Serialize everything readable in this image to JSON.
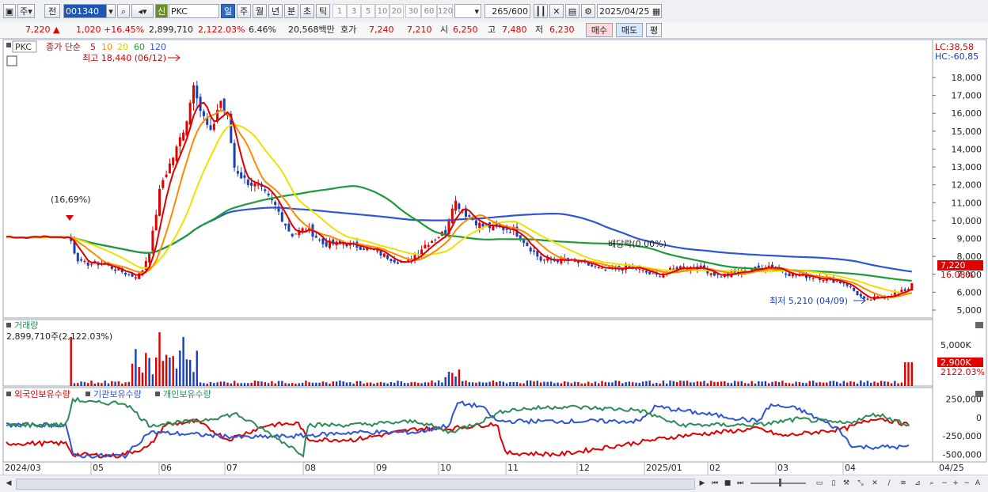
{
  "toolbar": {
    "period_jong": "주",
    "prev_label": "전",
    "stock_code": "001340",
    "shin_label": "신",
    "stock_name": "PKC",
    "periods": [
      "일",
      "주",
      "월",
      "년",
      "분",
      "초",
      "틱"
    ],
    "active_period": "일",
    "intervals": [
      "1",
      "3",
      "5",
      "10",
      "20",
      "30",
      "60",
      "120"
    ],
    "count_display": "265",
    "count_total": "/600",
    "date": "2025/04/25"
  },
  "quote": {
    "price": "7,220",
    "change": "1,020",
    "change_pct": "+16.45%",
    "volume": "2,899,710",
    "volume_pct": "2,122.03%",
    "turnover_pct": "6.46%",
    "amount": "20,568백만",
    "hoga_label": "호가",
    "ask": "7,240",
    "bid": "7,210",
    "open_label": "시",
    "open": "6,250",
    "high_label": "고",
    "high": "7,480",
    "low_label": "저",
    "low": "6,230",
    "buy_label": "매수",
    "sell_label": "매도",
    "pyeong_label": "평"
  },
  "price_panel": {
    "ticker": "PKC",
    "ma_title": "종가 단순",
    "ma_periods": [
      "5",
      "10",
      "20",
      "60",
      "120"
    ],
    "ma_colors": [
      "#e00000",
      "#ff8a00",
      "#f0e000",
      "#1e9a3a",
      "#2f55d4"
    ],
    "high_annot": "최고 18,440 (06/12)",
    "low_annot": "최저 5,210 (04/09)",
    "pct_annot": "(16,69%)",
    "div_annot": "배당락(0.00%)",
    "lc": "LC:38,58",
    "hc": "HC:-60,85",
    "price_tag": "7,220",
    "price_tag_pct": "16.08%",
    "yticks": [
      "18,000",
      "17,000",
      "16,000",
      "15,000",
      "14,000",
      "13,000",
      "12,000",
      "11,000",
      "10,000",
      "9,000",
      "8,000",
      "7,000",
      "6,000",
      "5,000"
    ]
  },
  "volume_panel": {
    "title": "거래량",
    "value": "2,899,710주(2,122.03%)",
    "yticks": [
      "5,000K"
    ],
    "tag": "2,900K",
    "tag_pct": "2122.03%"
  },
  "holding_panel": {
    "series_names": [
      "외국인보유수량",
      "기관보유수량",
      "개인보유수량"
    ],
    "series_colors": [
      "#e00000",
      "#2f55d4",
      "#2e8b57"
    ],
    "yticks": [
      "250,000",
      "0",
      "-250,000",
      "-500,000"
    ]
  },
  "xaxis": {
    "labels": [
      "2024/03",
      "05",
      "06",
      "07",
      "08",
      "09",
      "10",
      "11",
      "12",
      "2025/01",
      "02",
      "03",
      "04"
    ],
    "right_label": "04/25"
  },
  "chart_data": {
    "type": "candlestick",
    "title": "PKC",
    "y_range": [
      5000,
      18500
    ],
    "approx_close_path": [
      {
        "t": "2024/03",
        "close": 9100
      },
      {
        "t": "2024/04",
        "close": 7700
      },
      {
        "t": "2024/05",
        "close": 6700
      },
      {
        "t": "2024/06/12",
        "close": 18440
      },
      {
        "t": "2024/07",
        "close": 13000
      },
      {
        "t": "2024/08",
        "close": 9000
      },
      {
        "t": "2024/09",
        "close": 7400
      },
      {
        "t": "2024/10",
        "close": 11200
      },
      {
        "t": "2024/11",
        "close": 9200
      },
      {
        "t": "2024/12",
        "close": 7200
      },
      {
        "t": "2025/01",
        "close": 7300
      },
      {
        "t": "2025/02",
        "close": 6800
      },
      {
        "t": "2025/03",
        "close": 6700
      },
      {
        "t": "2025/04/09",
        "close": 5210
      },
      {
        "t": "2025/04/25",
        "close": 7220
      }
    ]
  }
}
